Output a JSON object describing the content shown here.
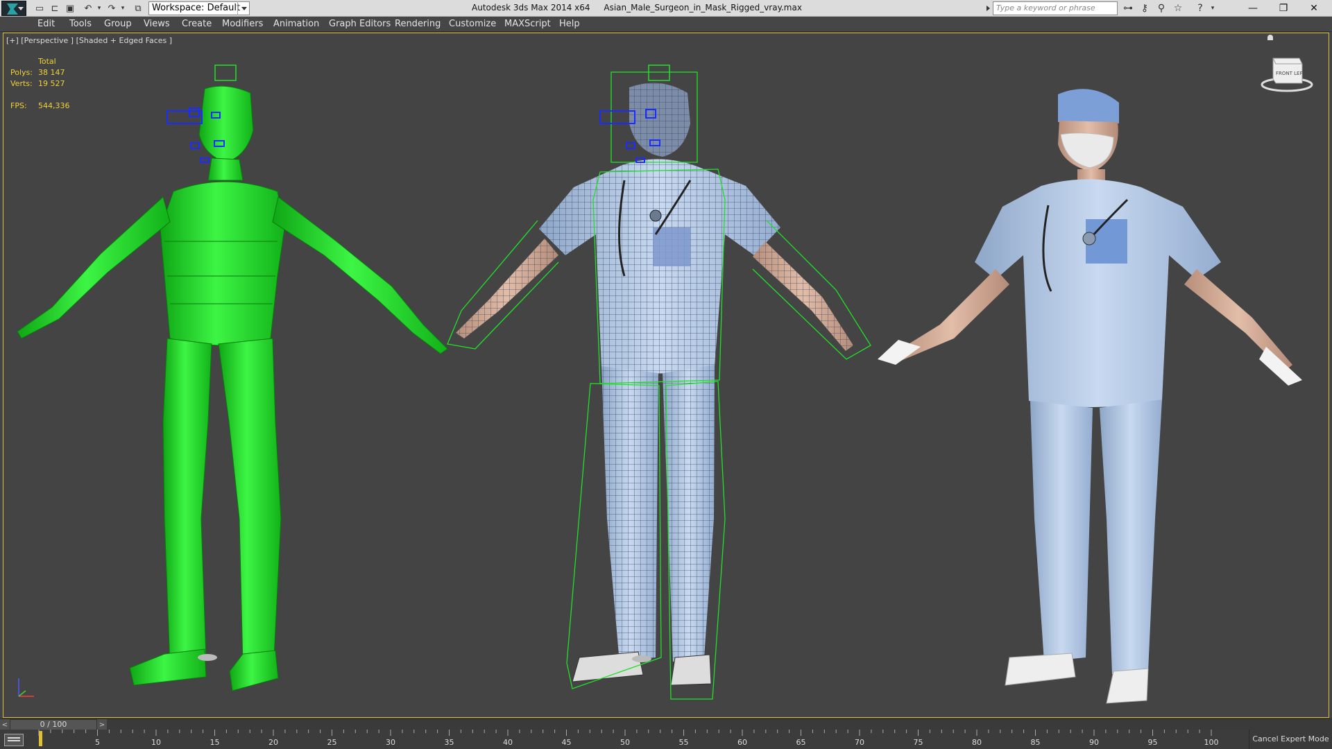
{
  "titlebar": {
    "workspace": "Workspace: Default",
    "app_name": "Autodesk 3ds Max  2014 x64",
    "file_name": "Asian_Male_Surgeon_in_Mask_Rigged_vray.max",
    "search_placeholder": "Type a keyword or phrase"
  },
  "menu": {
    "items": [
      {
        "label": "Edit"
      },
      {
        "label": "Tools"
      },
      {
        "label": "Group"
      },
      {
        "label": "Views"
      },
      {
        "label": "Create"
      },
      {
        "label": "Modifiers"
      },
      {
        "label": "Animation"
      },
      {
        "label": "Graph Editors"
      },
      {
        "label": "Rendering"
      },
      {
        "label": "Customize"
      },
      {
        "label": "MAXScript"
      },
      {
        "label": "Help"
      }
    ]
  },
  "viewport": {
    "label": "[+] [Perspective ] [Shaded + Edged Faces ]",
    "stats": {
      "header": "Total",
      "polys_label": "Polys:",
      "polys_value": "38 147",
      "verts_label": "Verts:",
      "verts_value": "19 527",
      "fps_label": "FPS:",
      "fps_value": "544,336"
    },
    "viewcube_label": "FRONT  LEFT"
  },
  "timeline": {
    "frame_display": "0 / 100",
    "ticks": [
      5,
      10,
      15,
      20,
      25,
      30,
      35,
      40,
      45,
      50,
      55,
      60,
      65,
      70,
      75,
      80,
      85,
      90,
      95,
      100
    ],
    "cancel_label": "Cancel Expert Mode"
  },
  "colors": {
    "accent_yellow": "#f0d23c",
    "rig_green": "#22e02a",
    "scrubs_blue": "#a9c3e6"
  }
}
